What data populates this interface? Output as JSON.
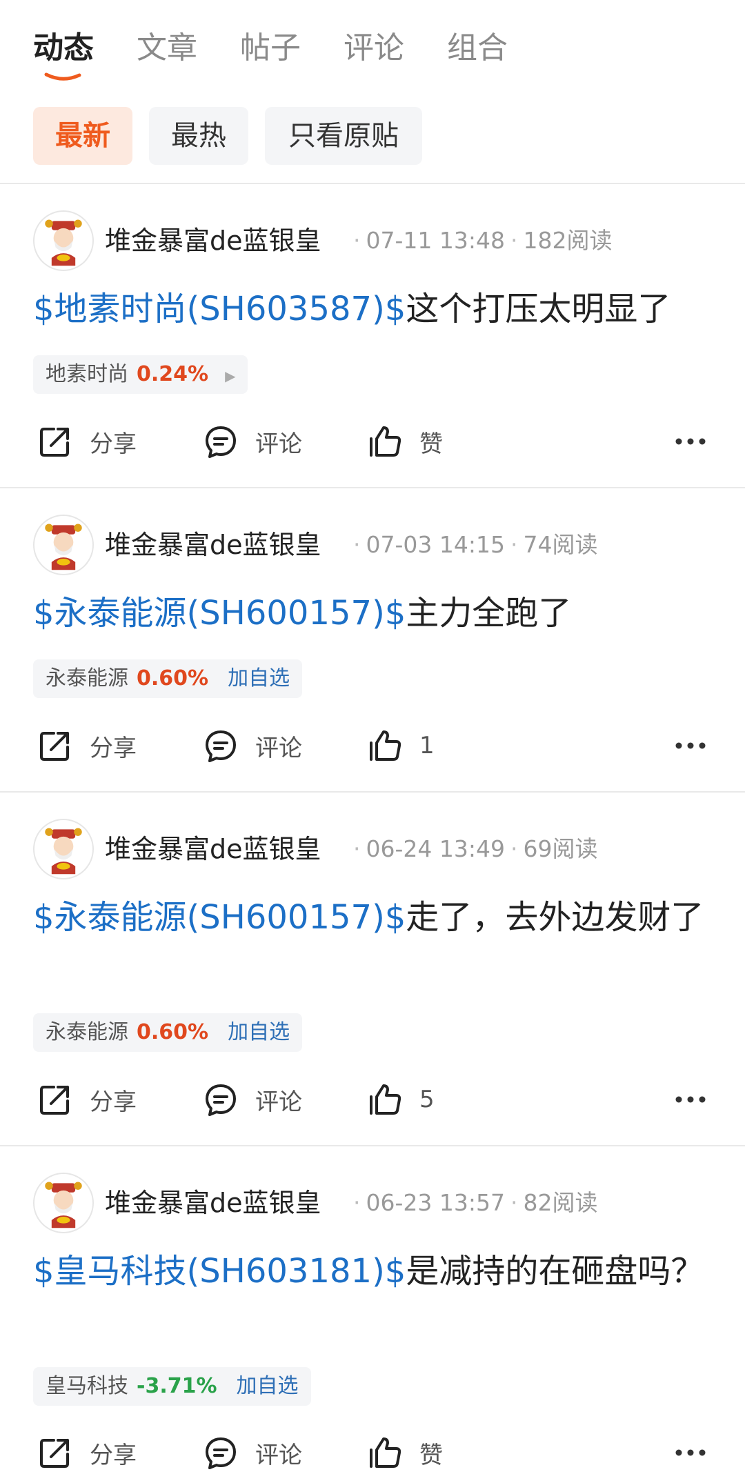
{
  "top_tabs": [
    "动态",
    "文章",
    "帖子",
    "评论",
    "组合"
  ],
  "filters": [
    "最新",
    "最热",
    "只看原贴"
  ],
  "actions": {
    "share": "分享",
    "comment": "评论",
    "like": "赞"
  },
  "colors": {
    "accent": "#ef5b1e",
    "link": "#1c6fc6",
    "up": "#e0481e",
    "down": "#2aa24a"
  },
  "posts": [
    {
      "author": "堆金暴富de蓝银皇",
      "date": "07-11 13:48",
      "reads": "182阅读",
      "stock_link": "$地素时尚(SH603587)$",
      "text": "这个打压太明显了",
      "tag": {
        "name": "地素时尚",
        "change": "0.24%",
        "extra": ""
      },
      "likes": "赞"
    },
    {
      "author": "堆金暴富de蓝银皇",
      "date": "07-03 14:15",
      "reads": "74阅读",
      "stock_link": "$永泰能源(SH600157)$",
      "text": "主力全跑了",
      "tag": {
        "name": "永泰能源",
        "change": "0.60%",
        "extra": "加自选"
      },
      "likes": "1"
    },
    {
      "author": "堆金暴富de蓝银皇",
      "date": "06-24 13:49",
      "reads": "69阅读",
      "stock_link": "$永泰能源(SH600157)$",
      "text": "走了，去外边发财了",
      "tag": {
        "name": "永泰能源",
        "change": "0.60%",
        "extra": "加自选"
      },
      "likes": "5"
    },
    {
      "author": "堆金暴富de蓝银皇",
      "date": "06-23 13:57",
      "reads": "82阅读",
      "stock_link": "$皇马科技(SH603181)$",
      "text": "是减持的在砸盘吗？",
      "tag": {
        "name": "皇马科技",
        "change": "-3.71%",
        "extra": "加自选"
      },
      "likes": "赞"
    }
  ]
}
